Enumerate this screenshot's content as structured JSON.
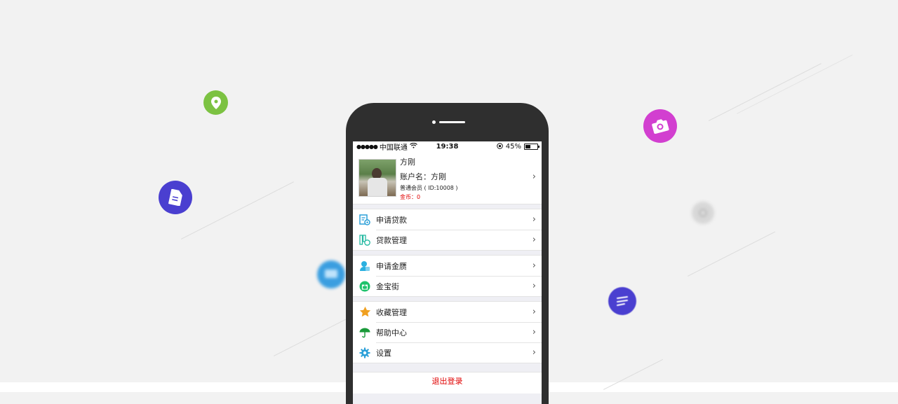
{
  "status_bar": {
    "signal": "●●●●●",
    "carrier": "中国联通",
    "time": "19:38",
    "battery_text": "45%",
    "battery_level": 0.45
  },
  "profile": {
    "name": "方刚",
    "account": "账户名：方刚",
    "level": "普通会员 ( ID:10008 )",
    "coins": "金币：0"
  },
  "menu_groups": [
    [
      {
        "label": "申请贷款",
        "icon": "apply-loan-icon",
        "color": "#2a9fd8"
      },
      {
        "label": "贷款管理",
        "icon": "loan-management-icon",
        "color": "#22b8a0"
      }
    ],
    [
      {
        "label": "申请金赝",
        "icon": "apply-gold-icon",
        "color": "#2ab0e0"
      },
      {
        "label": "金宝街",
        "icon": "gift-icon",
        "color": "#1ec26b"
      }
    ],
    [
      {
        "label": "收藏管理",
        "icon": "star-icon",
        "color": "#f0a020"
      },
      {
        "label": "帮助中心",
        "icon": "umbrella-icon",
        "color": "#1a9a3a"
      },
      {
        "label": "设置",
        "icon": "gear-icon",
        "color": "#2a9fd8"
      }
    ]
  ],
  "logout_label": "退出登录",
  "chevron": "›",
  "colors": {
    "accent_red": "#e00000",
    "floating_green": "#7cc242",
    "floating_purple": "#4a3fd0",
    "floating_magenta": "#d23fd0",
    "floating_blue": "#3a9ee0"
  }
}
